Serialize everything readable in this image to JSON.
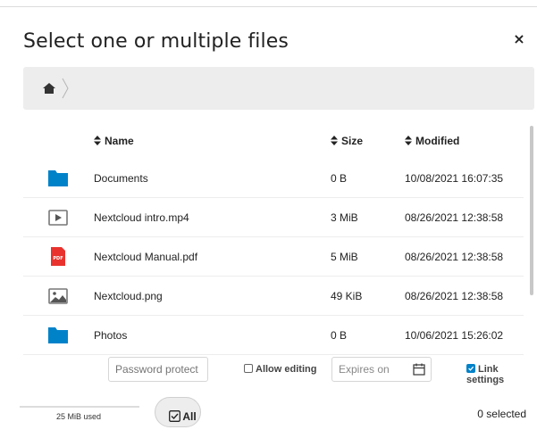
{
  "dialog": {
    "title": "Select one or multiple files",
    "close_label": "×"
  },
  "breadcrumb": {
    "home_icon": "home-icon"
  },
  "columns": {
    "name": "Name",
    "size": "Size",
    "modified": "Modified"
  },
  "files": [
    {
      "name": "Documents",
      "size": "0 B",
      "modified": "10/08/2021 16:07:35",
      "icon": "folder-icon"
    },
    {
      "name": "Nextcloud intro.mp4",
      "size": "3 MiB",
      "modified": "08/26/2021 12:38:58",
      "icon": "video-icon"
    },
    {
      "name": "Nextcloud Manual.pdf",
      "size": "5 MiB",
      "modified": "08/26/2021 12:38:58",
      "icon": "pdf-icon"
    },
    {
      "name": "Nextcloud.png",
      "size": "49 KiB",
      "modified": "08/26/2021 12:38:58",
      "icon": "image-icon"
    },
    {
      "name": "Photos",
      "size": "0 B",
      "modified": "10/06/2021 15:26:02",
      "icon": "folder-icon"
    }
  ],
  "share": {
    "password_placeholder": "Password protect",
    "allow_editing_label": "Allow editing",
    "allow_editing_checked": false,
    "expires_placeholder": "Expires on",
    "link_settings_label": "Link settings",
    "link_settings_checked": true
  },
  "footer": {
    "quota_text": "25 MiB used",
    "all_label": "All",
    "selected_text": "0 selected"
  },
  "colors": {
    "folder": "#0082c9",
    "pdf": "#e9322d",
    "accent": "#0082c9"
  }
}
